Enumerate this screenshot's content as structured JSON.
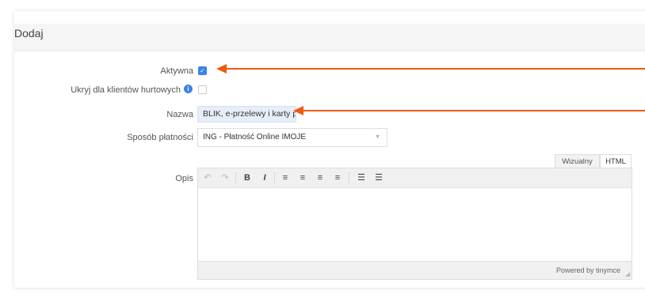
{
  "card": {
    "title": "Dodaj"
  },
  "form": {
    "active": {
      "label": "Aktywna",
      "checked": true
    },
    "hide_wholesale": {
      "label": "Ukryj dla klientów hurtowych",
      "checked": false,
      "info_icon": "info-icon"
    },
    "name": {
      "label": "Nazwa",
      "value": "BLIK, e-przelewy i karty pł"
    },
    "payment_method": {
      "label": "Sposób płatności",
      "value": "ING - Płatność Online IMOJE"
    },
    "description": {
      "label": "Opis"
    }
  },
  "editor": {
    "tabs": [
      {
        "label": "Wizualny",
        "active": false
      },
      {
        "label": "HTML",
        "active": true
      }
    ],
    "toolbar": {
      "undo": "↶",
      "redo": "↷",
      "bold": "B",
      "italic": "I",
      "align_left": "≡",
      "align_center": "≡",
      "align_right": "≡",
      "justify": "≡",
      "bullet_list": "☰",
      "numbered_list": "☰"
    },
    "powered_by": "Powered by tinymce"
  },
  "annotations": {
    "arrow_color": "#f05a12",
    "accent": "#3b82e8"
  }
}
